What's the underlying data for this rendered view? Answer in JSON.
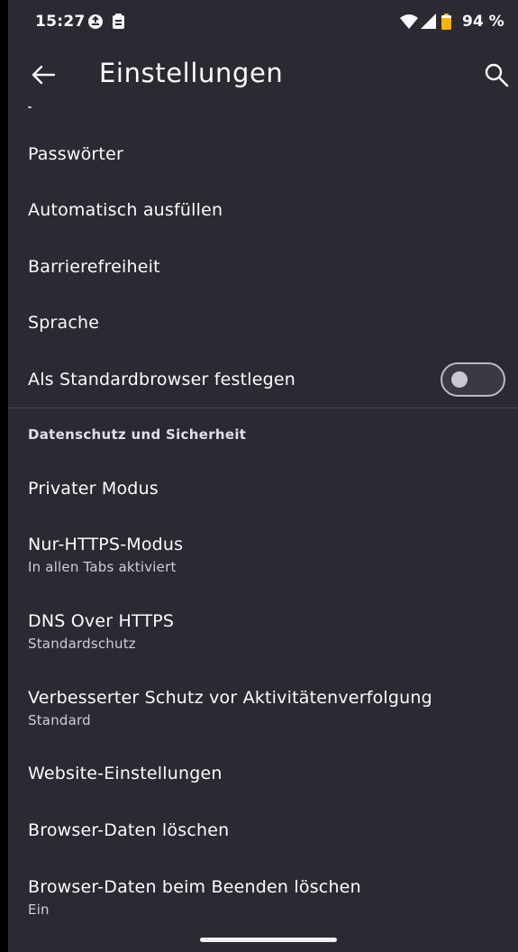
{
  "status_bar": {
    "time": "15:27",
    "battery_percent": "94 %",
    "icons": [
      "sync-icon",
      "clipboard-icon",
      "wifi-icon",
      "signal-icon",
      "battery-icon"
    ],
    "battery_color": "#f5b400"
  },
  "app_bar": {
    "title": "Einstellungen",
    "back_icon": "arrow-left-icon",
    "search_icon": "search-icon"
  },
  "general_items": [
    {
      "title": "Passwörter"
    },
    {
      "title": "Automatisch ausfüllen"
    },
    {
      "title": "Barrierefreiheit"
    },
    {
      "title": "Sprache"
    },
    {
      "title": "Als Standardbrowser festlegen",
      "toggle": false
    }
  ],
  "privacy_section": {
    "header": "Datenschutz und Sicherheit",
    "items": [
      {
        "title": "Privater Modus"
      },
      {
        "title": "Nur-HTTPS-Modus",
        "subtitle": "In allen Tabs aktiviert"
      },
      {
        "title": "DNS Over HTTPS",
        "subtitle": "Standardschutz"
      },
      {
        "title": "Verbesserter Schutz vor Aktivitätenverfolgung",
        "subtitle": "Standard"
      },
      {
        "title": "Website-Einstellungen"
      },
      {
        "title": "Browser-Daten löschen"
      },
      {
        "title": "Browser-Daten beim Beenden löschen",
        "subtitle": "Ein"
      }
    ]
  },
  "colors": {
    "background": "#2b2a33",
    "text_primary": "#fbfbfe",
    "text_secondary": "#cfcfd8",
    "divider": "#4a4953"
  }
}
